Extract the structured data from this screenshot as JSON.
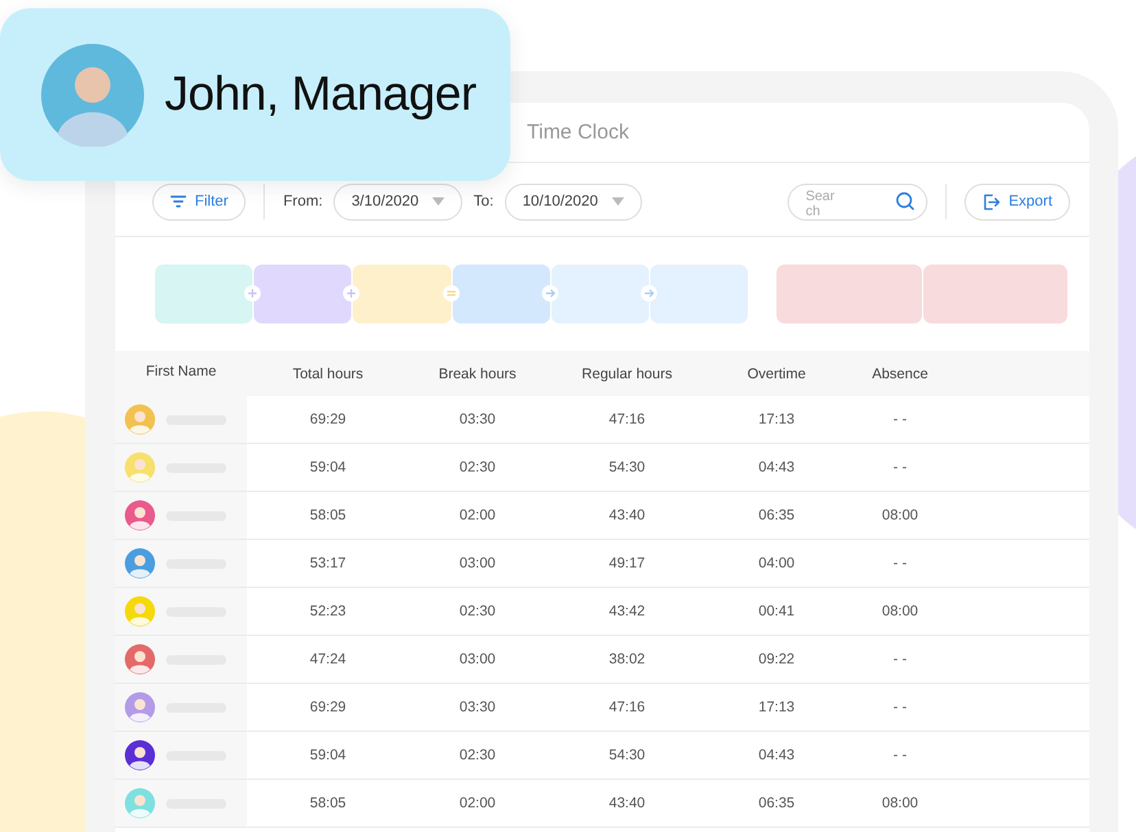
{
  "profile": {
    "name": "John, Manager"
  },
  "window": {
    "title": "Time Clock"
  },
  "toolbar": {
    "filter": "Filter",
    "from_label": "From:",
    "from_value": "3/10/2020",
    "to_label": "To:",
    "to_value": "10/10/2020",
    "search": {
      "placeholder": "Search"
    },
    "export": "Export"
  },
  "summary_groups": [
    {
      "tiles": [
        {
          "kind": "plus",
          "color": "#d6f5f3"
        },
        {
          "kind": "plus",
          "color": "#e0d9fd"
        },
        {
          "kind": "equals",
          "color": "#fff0cc"
        },
        {
          "kind": "arrow",
          "color": "#d4e8fd"
        },
        {
          "kind": "arrow",
          "color": "#e4f1fe"
        },
        {
          "kind": "end",
          "color": "#e4f1fe"
        }
      ]
    },
    {
      "tiles": [
        {
          "kind": "end",
          "color": "#f8dbdd"
        },
        {
          "kind": "end",
          "color": "#f8dbdd"
        }
      ]
    }
  ],
  "table": {
    "columns": [
      "First Name",
      "Total hours",
      "Break hours",
      "Regular hours",
      "Overtime",
      "Absence"
    ],
    "rows": [
      {
        "color": "#f2c14e",
        "cells": [
          "",
          "69:29",
          "03:30",
          "47:16",
          "17:13",
          "- -"
        ]
      },
      {
        "color": "#f7e06b",
        "cells": [
          "",
          "59:04",
          "02:30",
          "54:30",
          "04:43",
          "- -"
        ]
      },
      {
        "color": "#ea5a8c",
        "cells": [
          "",
          "58:05",
          "02:00",
          "43:40",
          "06:35",
          "08:00"
        ]
      },
      {
        "color": "#4a9ee0",
        "cells": [
          "",
          "53:17",
          "03:00",
          "49:17",
          "04:00",
          "- -"
        ]
      },
      {
        "color": "#f5d90a",
        "cells": [
          "",
          "52:23",
          "02:30",
          "43:42",
          "00:41",
          "08:00"
        ]
      },
      {
        "color": "#e46a6a",
        "cells": [
          "",
          "47:24",
          "03:00",
          "38:02",
          "09:22",
          "- -"
        ]
      },
      {
        "color": "#b39be8",
        "cells": [
          "",
          "69:29",
          "03:30",
          "47:16",
          "17:13",
          "- -"
        ]
      },
      {
        "color": "#5b2fd6",
        "cells": [
          "",
          "59:04",
          "02:30",
          "54:30",
          "04:43",
          "- -"
        ]
      },
      {
        "color": "#7fe0e0",
        "cells": [
          "",
          "58:05",
          "02:00",
          "43:40",
          "06:35",
          "08:00"
        ]
      }
    ]
  }
}
